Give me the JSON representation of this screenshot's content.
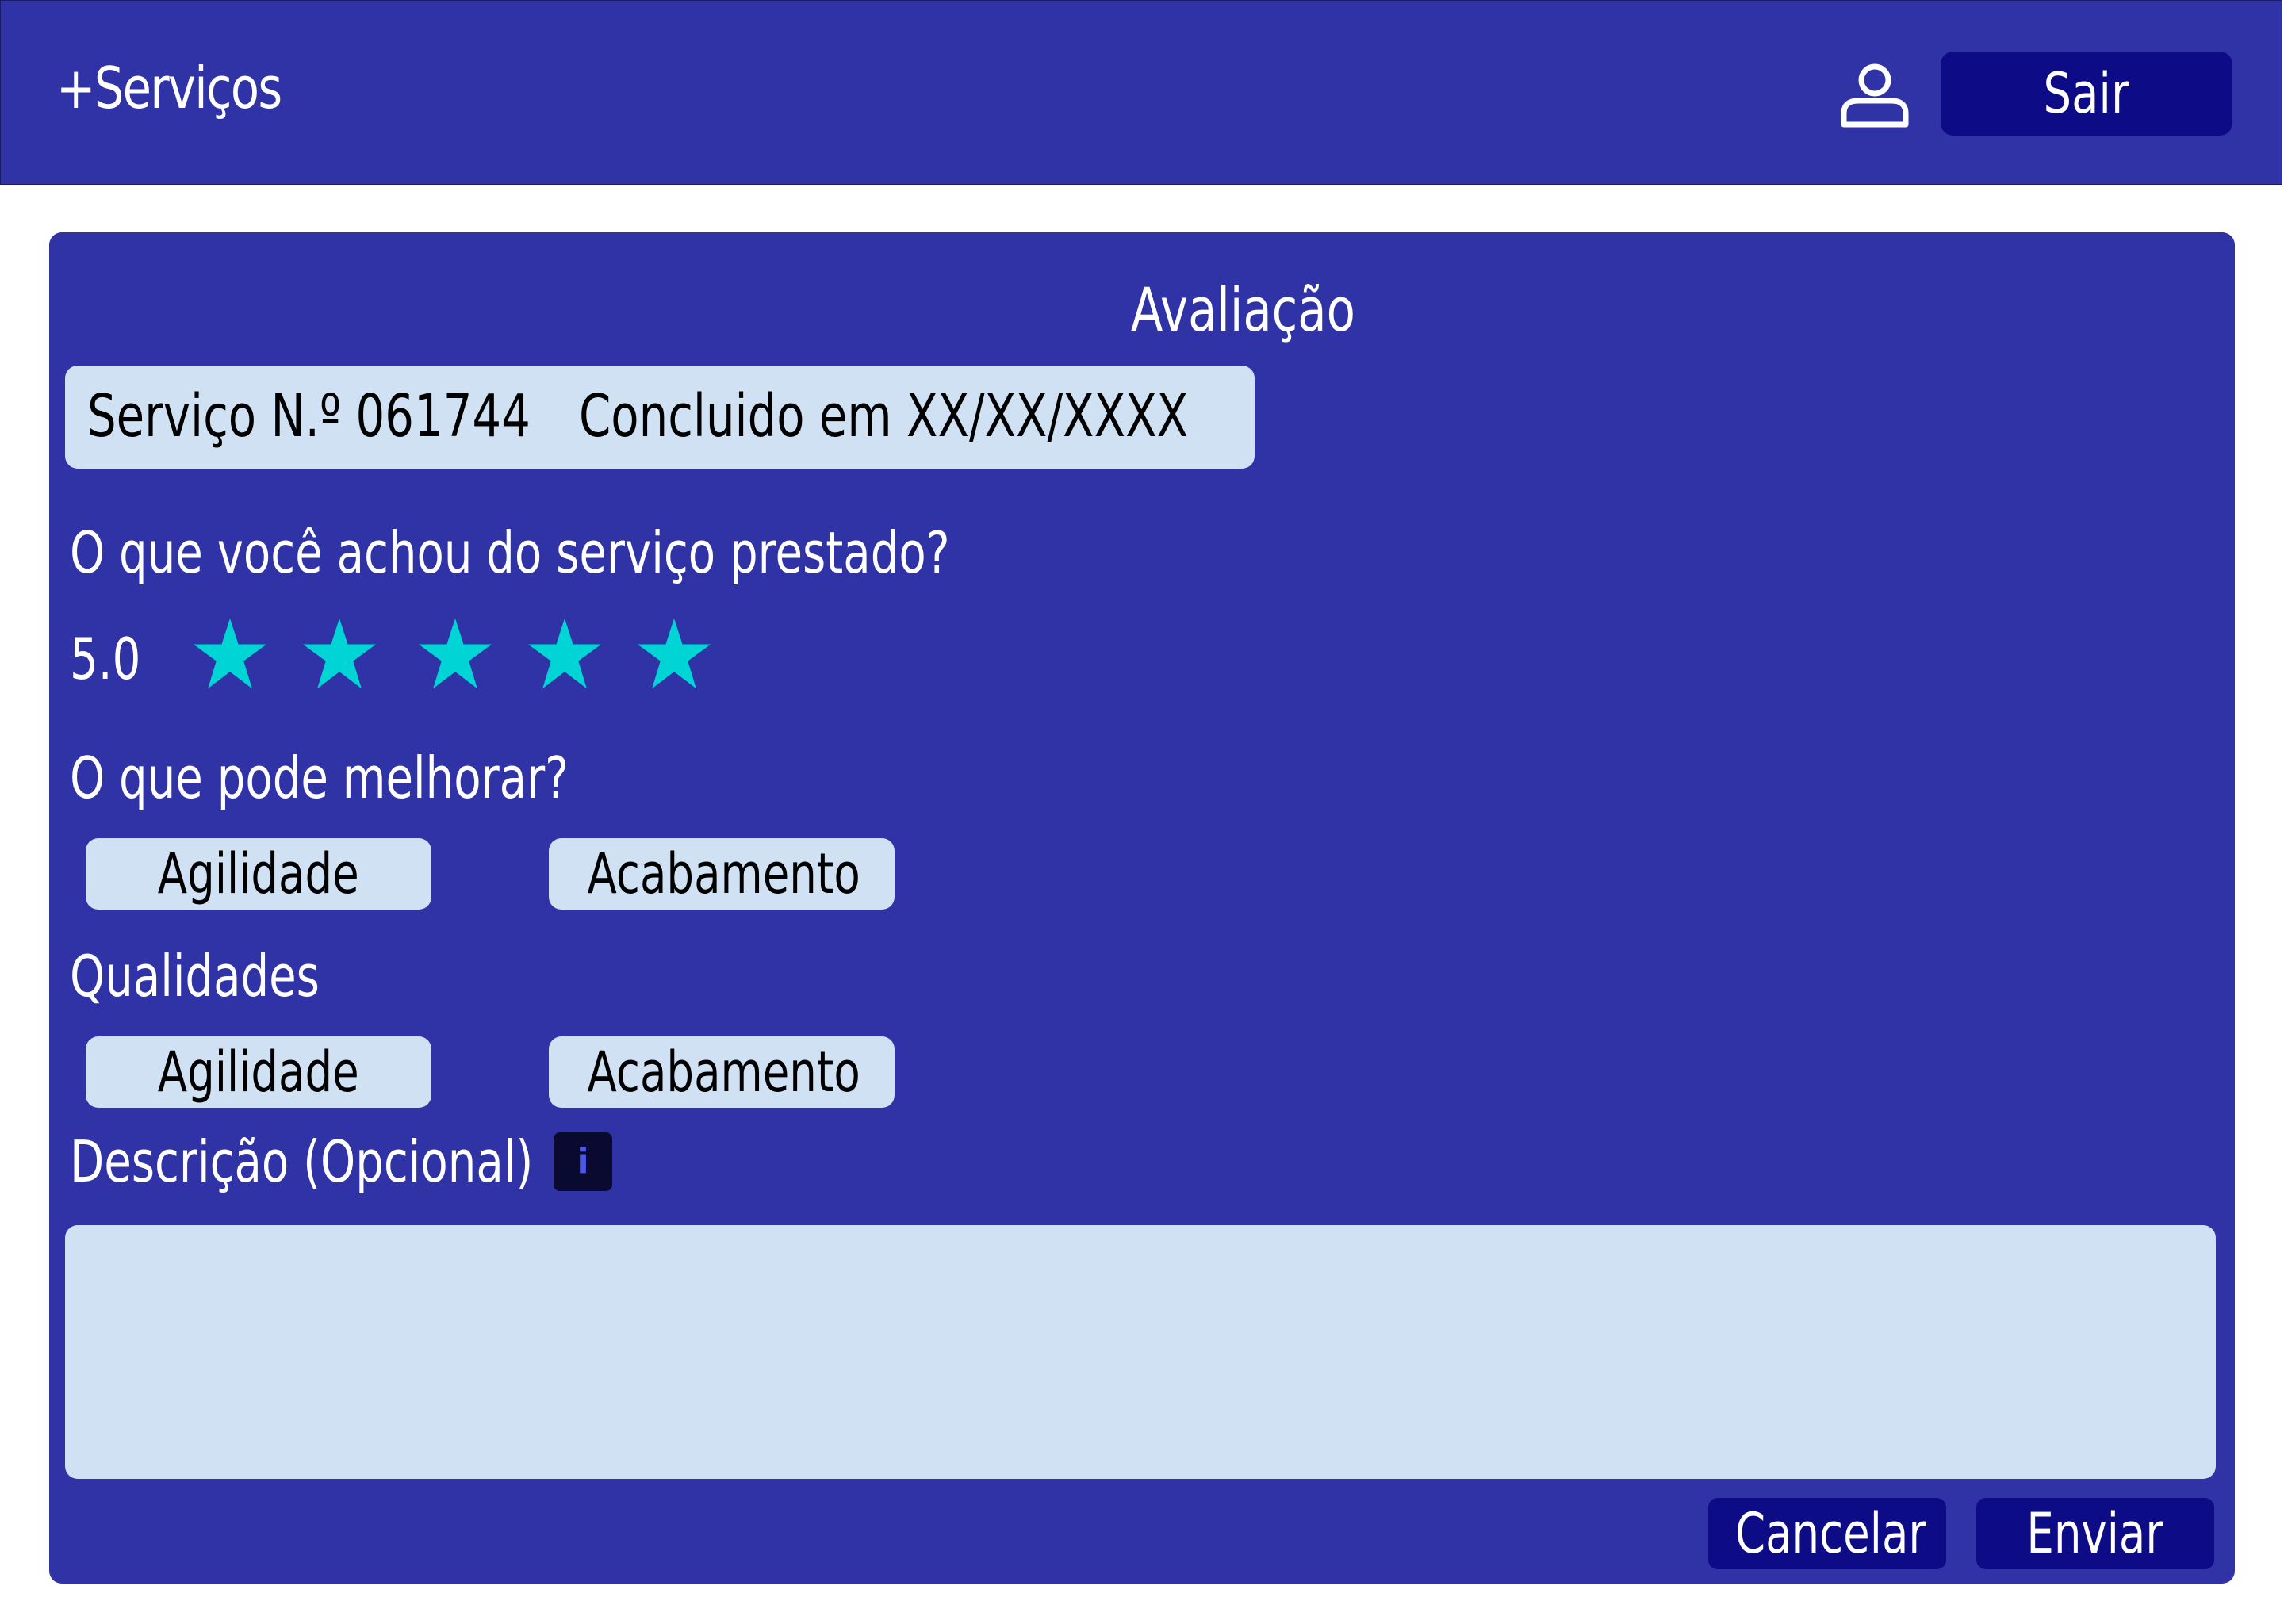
{
  "header": {
    "brand": "+Serviços",
    "user_icon": "user-icon",
    "logout_label": "Sair"
  },
  "evaluation": {
    "title": "Avaliação",
    "service_number": "Serviço N.º 061744",
    "completed_on": "Concluido em XX/XX/XXXX",
    "question_rating": "O que você achou do serviço prestado?",
    "rating_value": "5.0",
    "rating_stars": 5,
    "star_icon": "star-icon",
    "star_color": "#00d4d4",
    "question_improve": "O que pode melhorar?",
    "improve_options": [
      "Agilidade",
      "Acabamento"
    ],
    "qualities_label": "Qualidades",
    "quality_options": [
      "Agilidade",
      "Acabamento"
    ],
    "description_label": "Descrição (Opcional)",
    "info_icon": "info-icon",
    "description_value": "",
    "cancel_label": "Cancelar",
    "send_label": "Enviar"
  },
  "colors": {
    "primary": "#2f33a5",
    "button_dark": "#0d0b86",
    "light_field": "#cfe1f2",
    "page_background": "#ffffff"
  }
}
